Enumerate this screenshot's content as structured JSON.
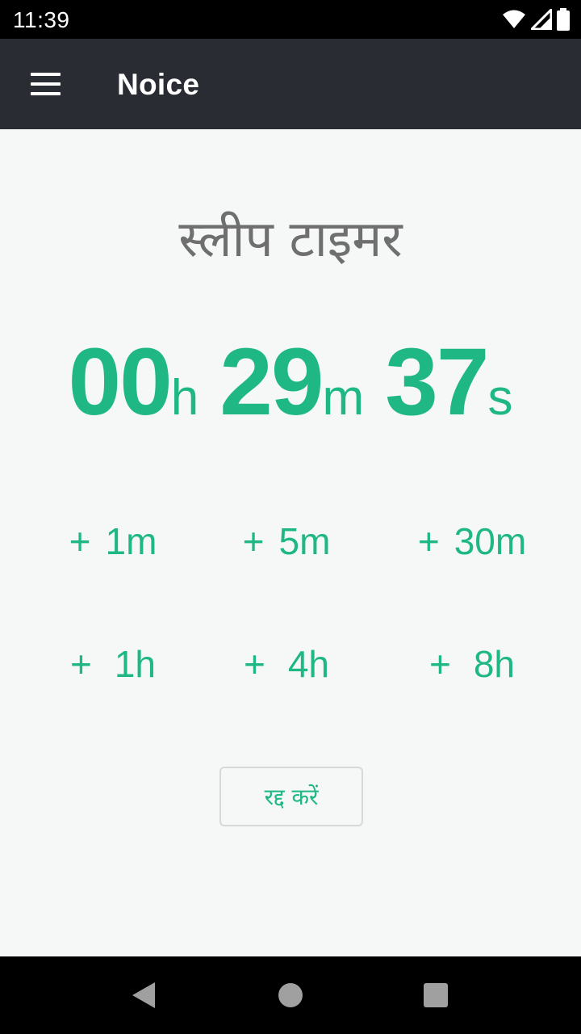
{
  "status_bar": {
    "time": "11:39",
    "icons": [
      "wifi-icon",
      "cell-signal-icon",
      "battery-icon"
    ]
  },
  "app_bar": {
    "title": "Noice",
    "menu_icon": "menu-icon"
  },
  "screen": {
    "title": "स्लीप टाइमर"
  },
  "timer": {
    "hours": "00",
    "hours_unit": "h",
    "minutes": "29",
    "minutes_unit": "m",
    "seconds": "37",
    "seconds_unit": "s"
  },
  "add_buttons": [
    {
      "plus": "+",
      "label": "1m"
    },
    {
      "plus": "+",
      "label": "5m"
    },
    {
      "plus": "+",
      "label": "30m"
    },
    {
      "plus": "+",
      "label": "1h"
    },
    {
      "plus": "+",
      "label": "4h"
    },
    {
      "plus": "+",
      "label": "8h"
    }
  ],
  "cancel_button": {
    "label": "रद्द करें"
  },
  "colors": {
    "accent": "#1fb885",
    "app_bar": "#2a2c34",
    "background": "#f6f8f7",
    "title_text": "#6f6f6f"
  },
  "nav_bar": {
    "icons": [
      "back-icon",
      "home-icon",
      "recents-icon"
    ]
  }
}
